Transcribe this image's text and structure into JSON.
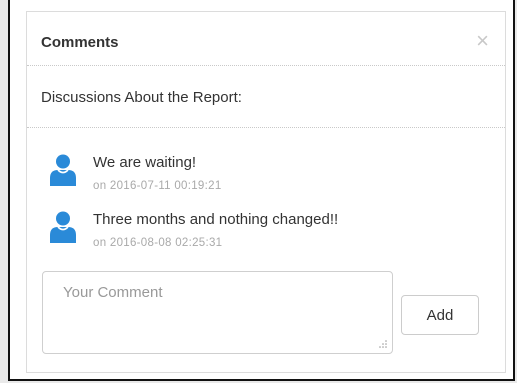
{
  "panel": {
    "title": "Comments",
    "close_glyph": "×",
    "subtitle": "Discussions About the Report:"
  },
  "comments": [
    {
      "icon": "user-icon",
      "text": "We are waiting!",
      "date": "on 2016-07-11 00:19:21"
    },
    {
      "icon": "user-icon",
      "text": "Three months and nothing changed!!",
      "date": "on 2016-08-08 02:25:31"
    }
  ],
  "form": {
    "placeholder": "Your Comment",
    "value": "",
    "add_label": "Add"
  },
  "colors": {
    "avatar": "#2a8ad8",
    "date_text": "#a9a9a9"
  }
}
